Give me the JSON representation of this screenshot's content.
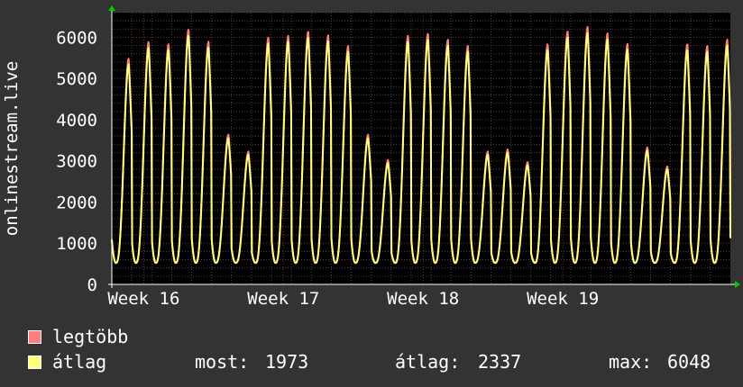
{
  "chart_data": {
    "type": "line",
    "ylabel": "onlinestream.live",
    "ylim": [
      0,
      6600
    ],
    "yticks": [
      0,
      1000,
      2000,
      3000,
      4000,
      5000,
      6000
    ],
    "ytick_labels": [
      "0",
      "1000",
      "2000",
      "3000",
      "4000",
      "5000",
      "6000"
    ],
    "xticks": [
      "Week 16",
      "Week 17",
      "Week 18",
      "Week 19"
    ],
    "x_unit": "day",
    "xlim": [
      0,
      31
    ],
    "week_positions": [
      1.6,
      8.6,
      15.6,
      22.6
    ],
    "daily_peaks_atlag": [
      5350,
      5750,
      5700,
      6050,
      5750,
      3550,
      3150,
      5850,
      5900,
      6000,
      5900,
      5650,
      3550,
      2950,
      5900,
      5950,
      5800,
      5650,
      3150,
      3200,
      2900,
      5700,
      6000,
      6100,
      5950,
      5700,
      3250,
      2800,
      5700,
      5650,
      5800,
      4000
    ],
    "daily_min": 520,
    "series": [
      {
        "name": "legtöbb",
        "color": "#ff7f7f",
        "peak_factor": 1.025
      },
      {
        "name": "átlag",
        "color": "#ffff7f",
        "peak_factor": 1.0
      }
    ],
    "grid": true,
    "stats": {
      "most_label": "most:",
      "most_value": "1973",
      "atlag_label": "átlag:",
      "atlag_value": "2337",
      "max_label": "max:",
      "max_value": "6048"
    }
  }
}
